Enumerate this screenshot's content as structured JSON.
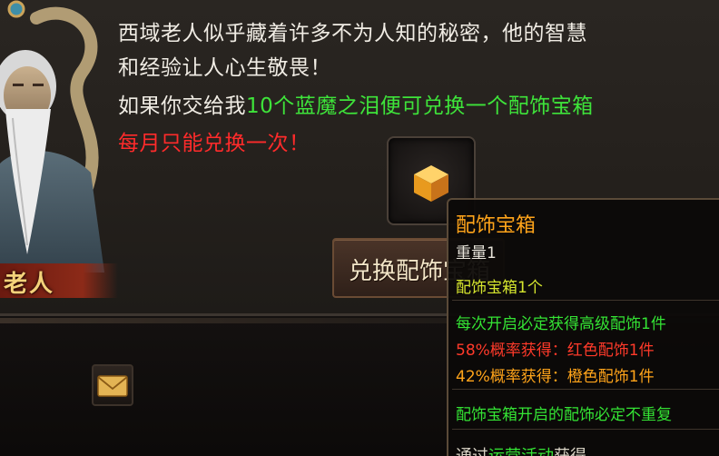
{
  "npc": {
    "name": "老人"
  },
  "dialog": {
    "line1": "西域老人似乎藏着许多不为人知的秘密，他的智慧",
    "line2": "和经验让人心生敬畏！",
    "line3_prefix": "如果你交给我",
    "line3_highlight": "10个蓝魔之泪便可兑换一个配饰宝箱",
    "line4": "每月只能兑换一次！"
  },
  "exchange_button": {
    "label": "兑换配饰宝箱"
  },
  "tooltip": {
    "title": "配饰宝箱",
    "weight": "重量1",
    "item_count": "配饰宝箱1个",
    "effect_line": "每次开启必定获得高级配饰1件",
    "red_chance": "58%概率获得：红色配饰1件",
    "orange_chance": "42%概率获得：橙色配饰1件",
    "note": "配饰宝箱开启的配饰必定不重复",
    "source_prefix": "通过",
    "source_highlight": "运营活动",
    "source_suffix": "获得"
  },
  "colors": {
    "highlight_green": "#3ee33a",
    "warning_red": "#ff2b2b",
    "title_orange": "#ffa41a",
    "name_gold": "#f4d27a"
  },
  "icons": {
    "item": "gold-cube-icon",
    "mail": "mail-envelope-icon",
    "portrait": "old-sage-portrait"
  }
}
